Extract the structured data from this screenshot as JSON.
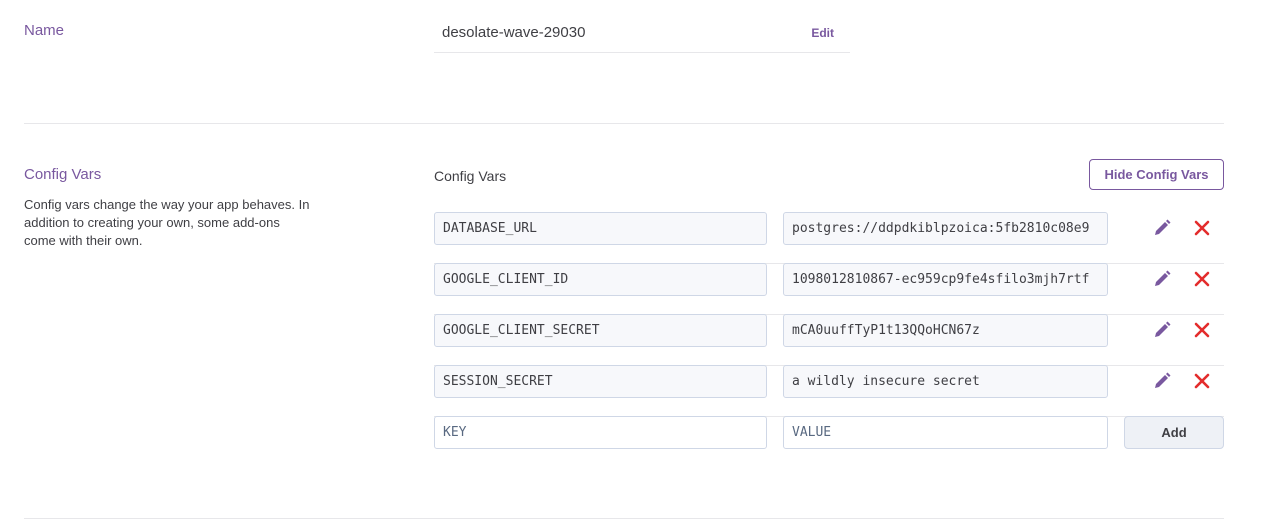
{
  "name_section": {
    "label": "Name",
    "value": "desolate-wave-29030",
    "edit_label": "Edit"
  },
  "config_section": {
    "label": "Config Vars",
    "description": "Config vars change the way your app behaves. In addition to creating your own, some add-ons come with their own.",
    "heading": "Config Vars",
    "hide_button_label": "Hide Config Vars",
    "vars": [
      {
        "key": "DATABASE_URL",
        "value": "postgres://ddpdkiblpzoica:5fb2810c08e9"
      },
      {
        "key": "GOOGLE_CLIENT_ID",
        "value": "1098012810867-ec959cp9fe4sfilo3mjh7rtf"
      },
      {
        "key": "GOOGLE_CLIENT_SECRET",
        "value": "mCA0uuffTyP1t13QQoHCN67z"
      },
      {
        "key": "SESSION_SECRET",
        "value": "a wildly insecure secret"
      }
    ],
    "new_var": {
      "key_placeholder": "KEY",
      "value_placeholder": "VALUE",
      "add_label": "Add"
    }
  },
  "colors": {
    "accent": "#79589f",
    "delete": "#e32c2c",
    "field_bg": "#f7f8fb",
    "field_border": "#cfd7e6"
  },
  "icons": {
    "edit": "pencil-icon",
    "delete": "close-x-icon"
  }
}
